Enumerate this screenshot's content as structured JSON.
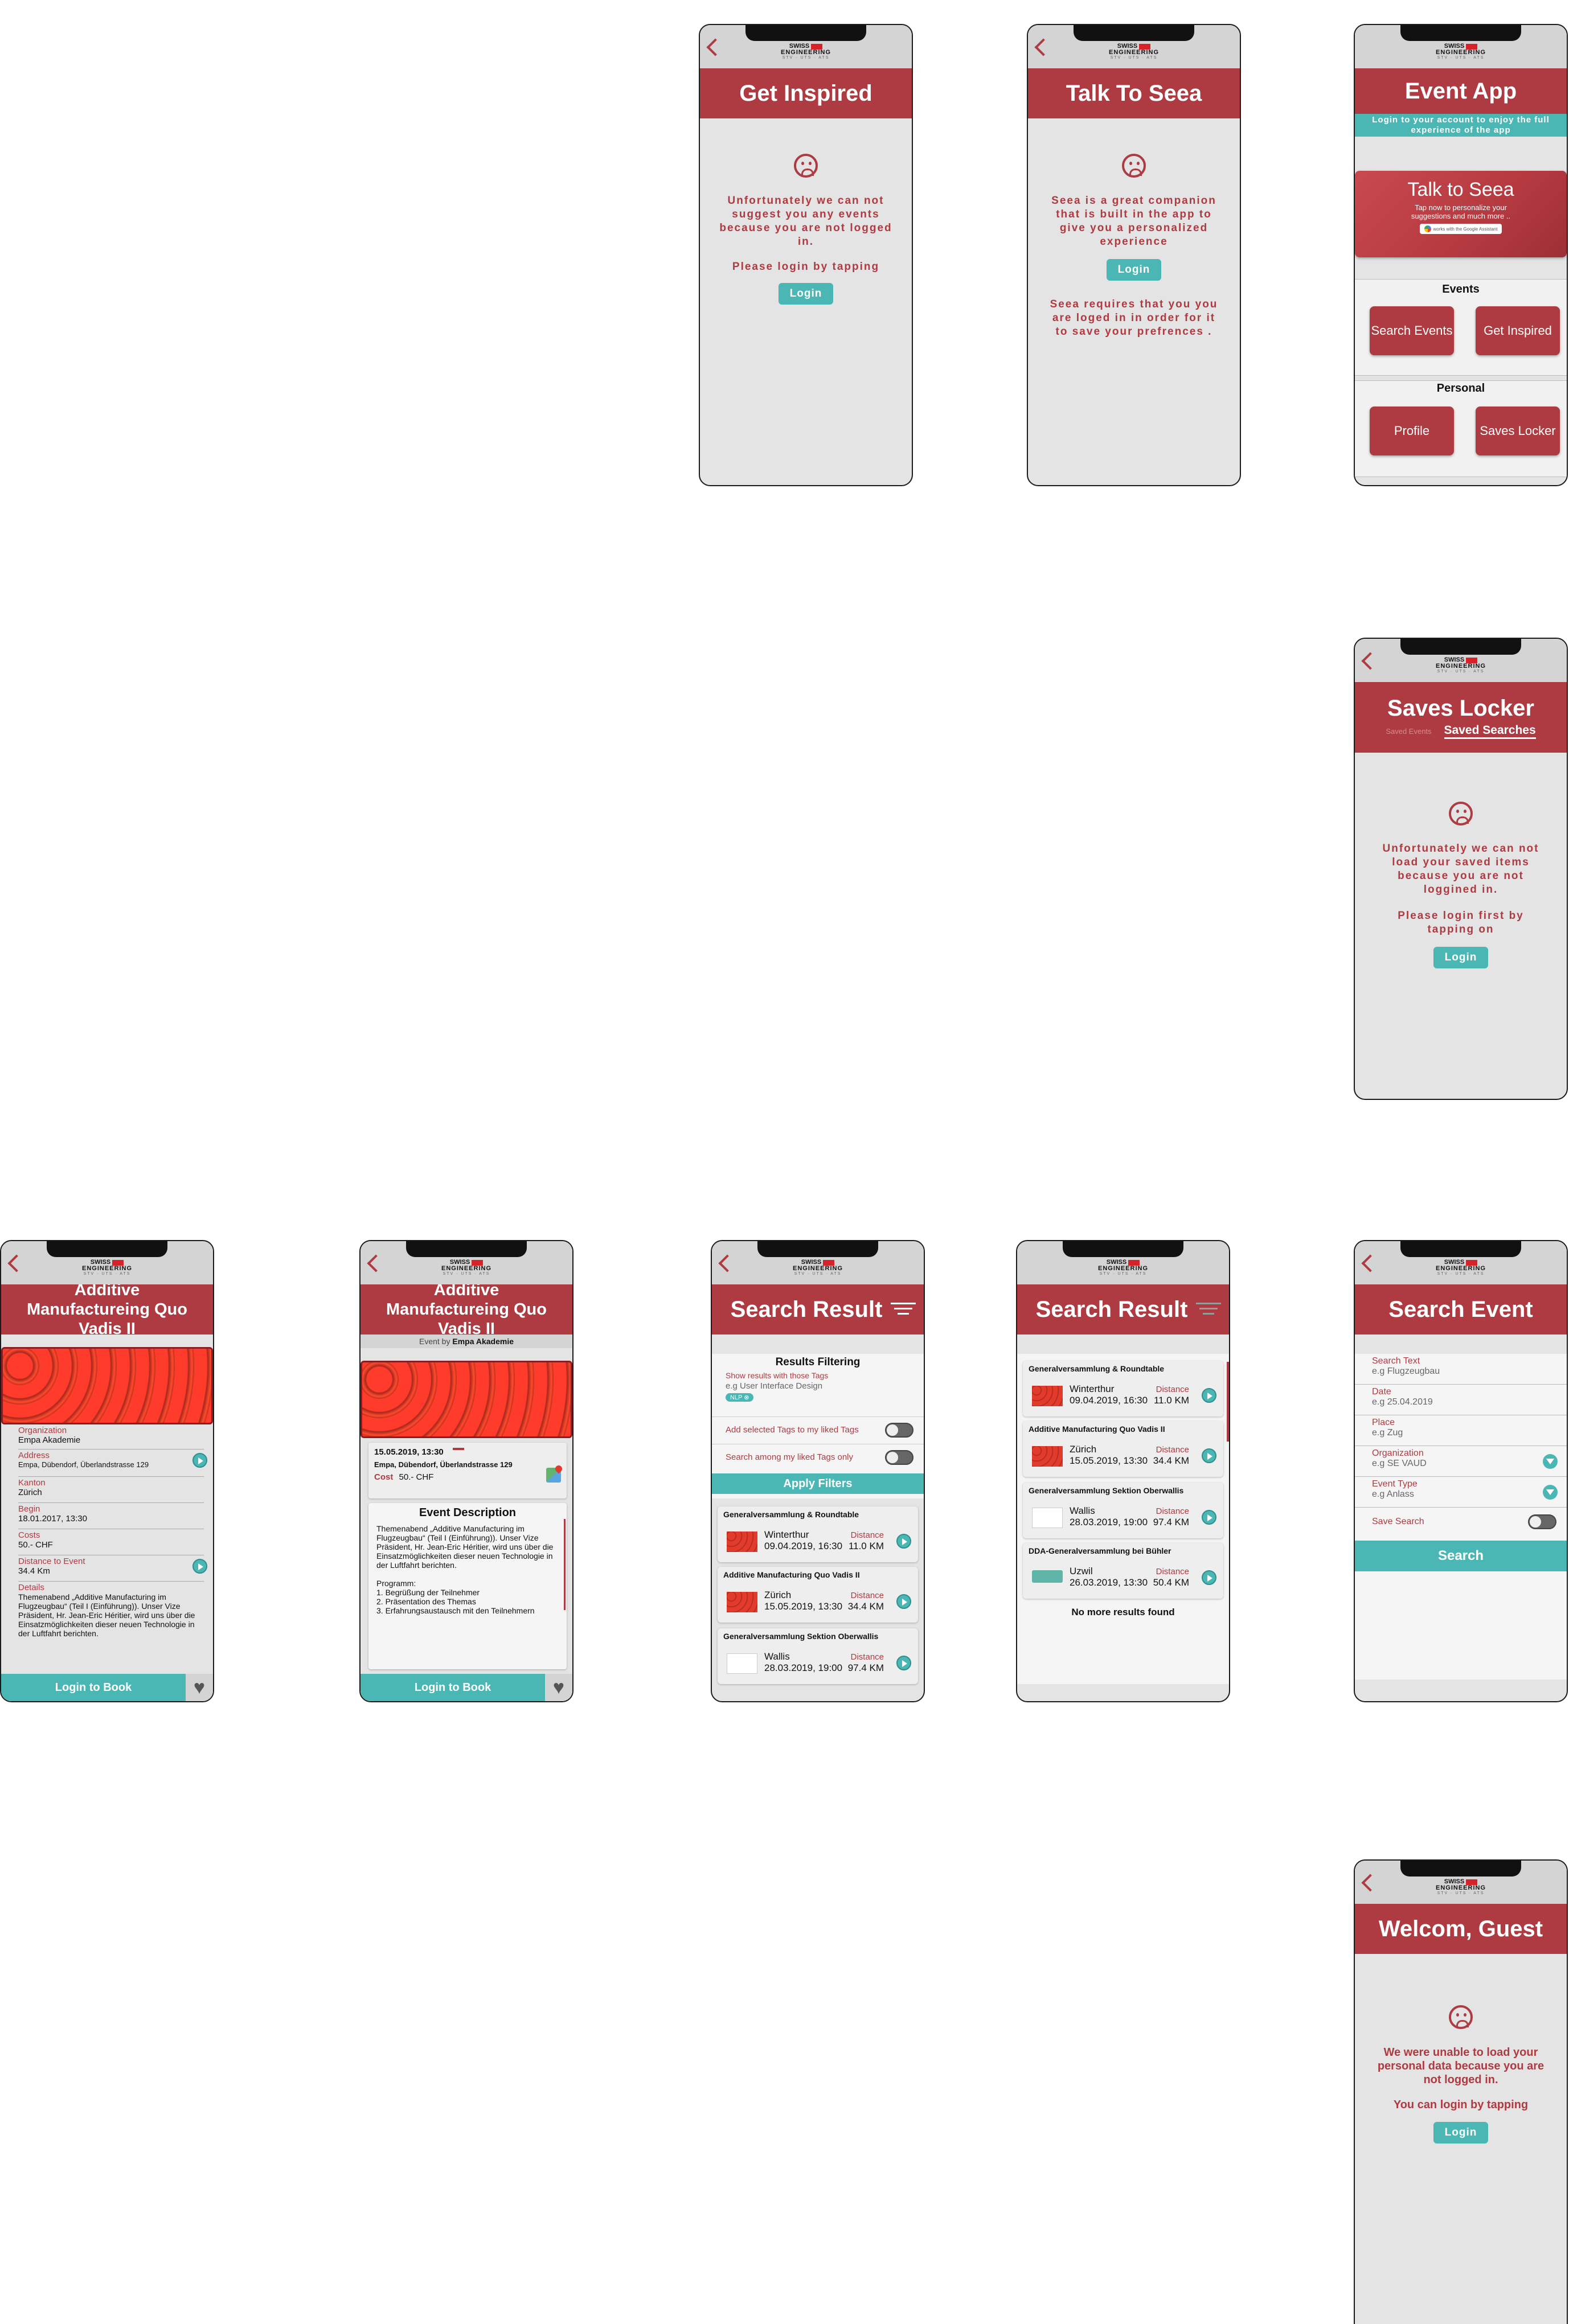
{
  "logo": {
    "line1": "SWISS",
    "line2": "ENGINEERING",
    "line3": "STV · UTS · ATS"
  },
  "get_inspired": {
    "title": "Get Inspired",
    "message": "Unfortunately we can not suggest you any events because you are not logged in.",
    "prompt": "Please login by tapping",
    "login": "Login"
  },
  "talk_to_seea": {
    "title": "Talk To Seea",
    "message": "Seea is a great companion that is built in the app to give you a personalized experience",
    "login": "Login",
    "note": "Seea requires that you you are loged in in order for it to save your prefrences ."
  },
  "event_app": {
    "title": "Event App",
    "banner": "Login to your account to enjoy the full experience of the app",
    "seea_card": {
      "title": "Talk to Seea",
      "subtitle": "Tap now to personalize your suggestions and much more ..",
      "badge": "works with the Google Assistant"
    },
    "events_section": "Events",
    "search_events": "Search Events",
    "get_inspired": "Get Inspired",
    "personal_section": "Personal",
    "profile": "Profile",
    "saves_locker": "Saves Locker"
  },
  "saves_locker": {
    "title": "Saves Locker",
    "tab_events": "Saved Events",
    "tab_searches": "Saved Searches",
    "message": "Unfortunately we can not load your saved items because you are not loggined in.",
    "prompt": "Please login first by tapping on",
    "login": "Login"
  },
  "event_detail_1": {
    "title": "Additive Manufactureing Quo Vadis II",
    "rows": [
      {
        "label": "Organization",
        "value": "Empa Akademie"
      },
      {
        "label": "Address",
        "value": "Empa, Dübendorf, Überlandstrasse 129"
      },
      {
        "label": "Kanton",
        "value": "Zürich"
      },
      {
        "label": "Begin",
        "value": "18.01.2017, 13:30"
      },
      {
        "label": "Costs",
        "value": "50.- CHF"
      },
      {
        "label": "Distance to Event",
        "value": "34.4 Km"
      },
      {
        "label": "Details",
        "value": "Themenabend „Additive Manufacturing im Flugzeugbau“ (Teil I (Einführung)). Unser Vize Präsident, Hr. Jean-Eric Héritier, wird uns über die Einsatzmöglichkeiten dieser neuen Technologie in der Luftfahrt berichten."
      }
    ],
    "book": "Login to Book"
  },
  "event_detail_2": {
    "title": "Additive Manufactureing Quo Vadis II",
    "event_by_prefix": "Event by",
    "event_by": "Empa Akademie",
    "datetime": "15.05.2019, 13:30",
    "address": "Empa, Dübendorf, Überlandstrasse 129",
    "cost_label": "Cost",
    "cost": "50.- CHF",
    "desc_title": "Event Description",
    "desc": "Themenabend „Additive Manufacturing im Flugzeugbau“ (Teil I (Einführung)). Unser Vize Präsident, Hr. Jean-Eric Héritier, wird uns über die Einsatzmöglichkeiten dieser neuen Technologie in der Luftfahrt berichten.",
    "program_title": "Programm:",
    "program": [
      "1. Begrüßung der Teilnehmer",
      "2. Präsentation des Themas",
      "3. Erfahrungsaustausch mit den Teilnehmern"
    ],
    "book": "Login to Book"
  },
  "search_result_filter": {
    "title": "Search Result",
    "filter_title": "Results Filtering",
    "tags_label": "Show results with those Tags",
    "tags_placeholder": "e.g User Interface Design",
    "nlp": "NLP ⊗",
    "add_tags": "Add selected Tags to my liked Tags",
    "search_liked": "Search among my liked Tags only",
    "apply": "Apply Filters",
    "results": [
      {
        "title": "Generalversammlung & Roundtable",
        "place": "Winterthur",
        "date": "09.04.2019, 16:30",
        "dist_label": "Distance",
        "dist": "11.0 KM"
      },
      {
        "title": "Additive Manufacturing Quo Vadis II",
        "place": "Zürich",
        "date": "15.05.2019, 13:30",
        "dist_label": "Distance",
        "dist": "34.4 KM"
      },
      {
        "title": "Generalversammlung Sektion Oberwallis",
        "place": "Wallis",
        "date": "28.03.2019, 19:00",
        "dist_label": "Distance",
        "dist": "97.4 KM"
      }
    ]
  },
  "search_result": {
    "title": "Search Result",
    "results": [
      {
        "title": "Generalversammlung & Roundtable",
        "place": "Winterthur",
        "date": "09.04.2019, 16:30",
        "dist_label": "Distance",
        "dist": "11.0 KM"
      },
      {
        "title": "Additive Manufacturing Quo Vadis II",
        "place": "Zürich",
        "date": "15.05.2019, 13:30",
        "dist_label": "Distance",
        "dist": "34.4 KM"
      },
      {
        "title": "Generalversammlung Sektion Oberwallis",
        "place": "Wallis",
        "date": "28.03.2019, 19:00",
        "dist_label": "Distance",
        "dist": "97.4 KM"
      },
      {
        "title": "DDA-Generalversammlung bei Bühler",
        "place": "Uzwil",
        "date": "26.03.2019, 13:30",
        "dist_label": "Distance",
        "dist": "50.4 KM"
      }
    ],
    "no_more": "No more results found"
  },
  "search_event": {
    "title": "Search Event",
    "fields": [
      {
        "label": "Search Text",
        "placeholder": "e.g Flugzeugbau"
      },
      {
        "label": "Date",
        "placeholder": "e.g 25.04.2019"
      },
      {
        "label": "Place",
        "placeholder": "e.g Zug"
      },
      {
        "label": "Organization",
        "placeholder": "e.g SE VAUD"
      },
      {
        "label": "Event Type",
        "placeholder": "e.g Anlass"
      }
    ],
    "save_search": "Save Search",
    "search": "Search"
  },
  "welcome_guest": {
    "title": "Welcom, Guest",
    "message": "We were unable to load your personal data because you are not logged in.",
    "prompt": "You can login by tapping",
    "login": "Login"
  },
  "colors": {
    "brand": "#ad3b41",
    "accent": "#4bb7b5",
    "screen": "#e4e4e4"
  }
}
